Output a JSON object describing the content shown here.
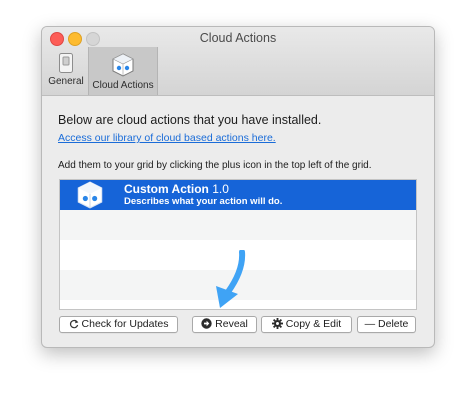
{
  "window": {
    "title": "Cloud Actions"
  },
  "tabs": [
    {
      "label": "General",
      "icon": "switch-icon"
    },
    {
      "label": "Cloud Actions",
      "icon": "cloud-cube-icon"
    }
  ],
  "content": {
    "intro": "Below are cloud actions that you have installed.",
    "library_link": "Access our library of cloud based actions here.",
    "hint": "Add them to your grid by clicking the plus icon in the top left of the grid."
  },
  "actions": [
    {
      "name": "Custom Action",
      "version": "1.0",
      "description": "Describes what your action will do."
    }
  ],
  "buttons": {
    "check_updates": "Check for Updates",
    "reveal": "Reveal",
    "copy_edit": "Copy & Edit",
    "delete": "— Delete"
  },
  "colors": {
    "selection": "#1664d8",
    "arrow": "#3fa3f5",
    "link": "#1a6cd8"
  }
}
